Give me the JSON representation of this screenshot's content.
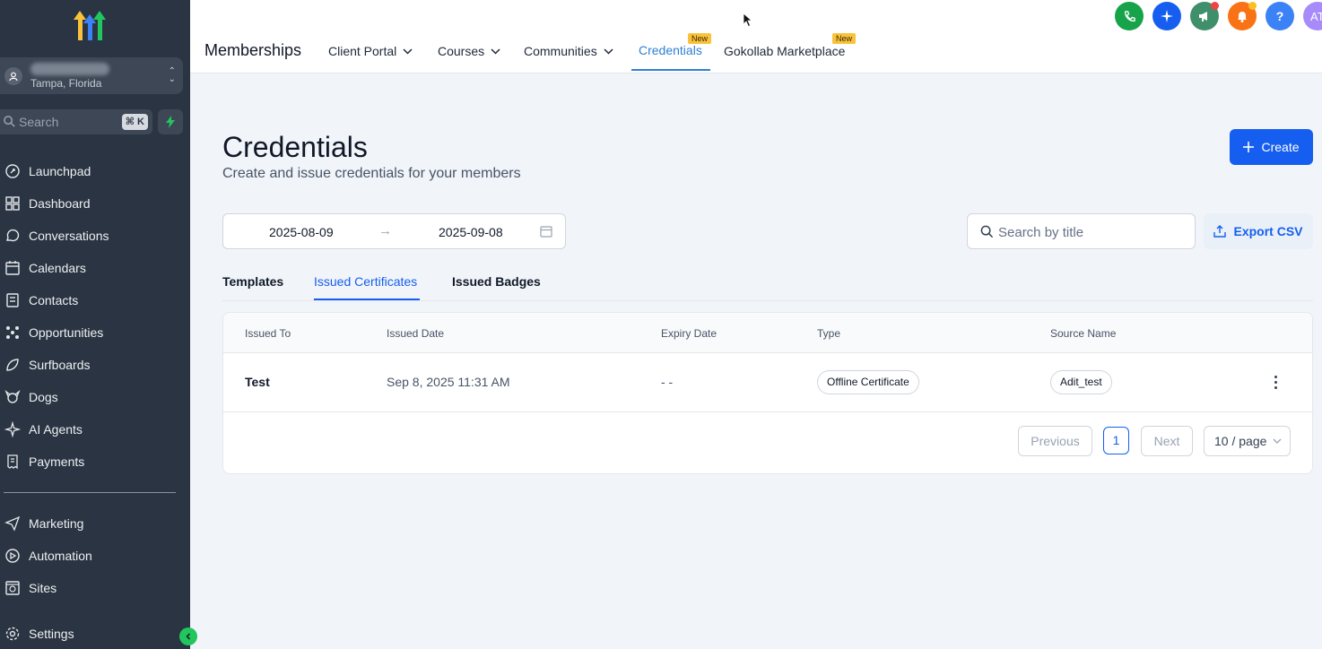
{
  "sidebar": {
    "account": {
      "location": "Tampa, Florida"
    },
    "search": {
      "placeholder": "Search",
      "shortcut": "⌘ K"
    },
    "items": [
      {
        "label": "Launchpad",
        "icon": "rocket-icon"
      },
      {
        "label": "Dashboard",
        "icon": "dashboard-icon"
      },
      {
        "label": "Conversations",
        "icon": "chat-icon"
      },
      {
        "label": "Calendars",
        "icon": "calendar-icon"
      },
      {
        "label": "Contacts",
        "icon": "contacts-icon"
      },
      {
        "label": "Opportunities",
        "icon": "opportunities-icon"
      },
      {
        "label": "Surfboards",
        "icon": "surfboard-icon"
      },
      {
        "label": "Dogs",
        "icon": "dog-icon"
      },
      {
        "label": "AI Agents",
        "icon": "sparkle-icon"
      },
      {
        "label": "Payments",
        "icon": "receipt-icon"
      },
      {
        "label": "Marketing",
        "icon": "send-icon"
      },
      {
        "label": "Automation",
        "icon": "automation-icon"
      },
      {
        "label": "Sites",
        "icon": "globe-icon"
      },
      {
        "label": "Settings",
        "icon": "gear-icon"
      }
    ]
  },
  "header": {
    "title": "Memberships",
    "tabs": [
      {
        "label": "Client Portal",
        "dropdown": true
      },
      {
        "label": "Courses",
        "dropdown": true
      },
      {
        "label": "Communities",
        "dropdown": true
      },
      {
        "label": "Credentials",
        "active": true,
        "badge": "New"
      },
      {
        "label": "Gokollab Marketplace",
        "badge": "New"
      }
    ],
    "icons": [
      "phone-icon",
      "sparkle-icon",
      "megaphone-icon",
      "bell-icon",
      "help-icon"
    ],
    "avatar_initials": "AT"
  },
  "page": {
    "title": "Credentials",
    "subtitle": "Create and issue credentials for your members",
    "create_label": "Create",
    "date_start": "2025-08-09",
    "date_end": "2025-09-08",
    "search_placeholder": "Search by title",
    "export_label": "Export CSV",
    "subtabs": [
      "Templates",
      "Issued Certificates",
      "Issued Badges"
    ]
  },
  "table": {
    "columns": [
      "Issued To",
      "Issued Date",
      "Expiry Date",
      "Type",
      "Source Name"
    ],
    "rows": [
      {
        "issued_to": "Test",
        "issued_date": "Sep 8, 2025 11:31 AM",
        "expiry_date": "- -",
        "type": "Offline Certificate",
        "source_name": "Adit_test"
      }
    ]
  },
  "pagination": {
    "previous": "Previous",
    "current": "1",
    "next": "Next",
    "page_size": "10 / page"
  },
  "colors": {
    "sidebar_bg": "#2a3442",
    "primary": "#155eef",
    "active_tab": "#2f7fd4",
    "badge": "#f9c23c"
  }
}
